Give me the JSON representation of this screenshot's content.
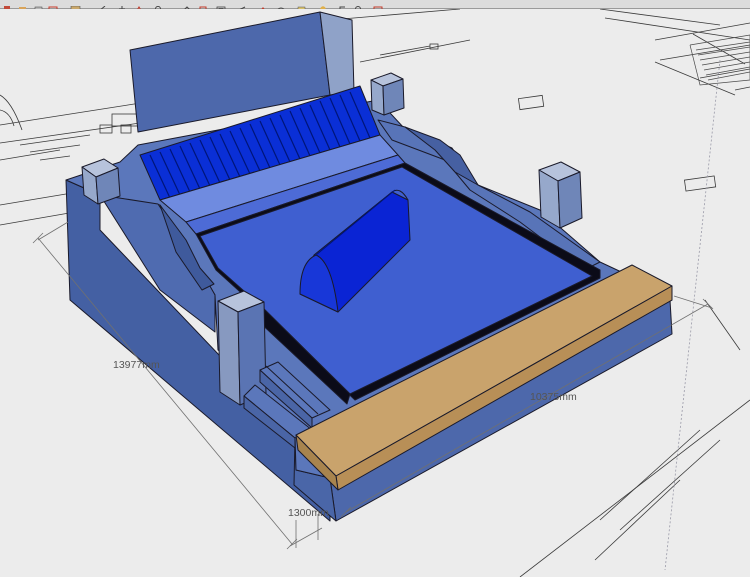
{
  "toolbar": {
    "buttons": [
      {
        "icon": "select-icon"
      },
      {
        "icon": "eraser-icon"
      },
      {
        "icon": "paint-bucket-icon"
      },
      {
        "icon": "rectangle-icon"
      },
      {
        "icon": "line-icon"
      },
      {
        "icon": "arc-icon"
      },
      {
        "icon": "move-icon"
      },
      {
        "icon": "push-pull-icon"
      },
      {
        "icon": "rotate-icon"
      },
      {
        "icon": "follow-me-icon"
      },
      {
        "icon": "scale-icon"
      },
      {
        "icon": "offset-icon"
      },
      {
        "icon": "tape-measure-icon"
      },
      {
        "icon": "dimension-icon"
      },
      {
        "icon": "protractor-icon"
      },
      {
        "icon": "text-icon"
      },
      {
        "icon": "orbit-icon"
      },
      {
        "icon": "pan-icon"
      },
      {
        "icon": "zoom-icon"
      },
      {
        "icon": "zoom-extents-icon"
      }
    ]
  },
  "model": {
    "dimensions": {
      "length": "13977mm",
      "width": "10375mm",
      "step_height": "1300mm"
    }
  },
  "colors": {
    "background": "#ececec",
    "structure_side": "#4a65a6",
    "structure_top": "#5b78be",
    "pool_surface": "#3f5fd0",
    "ramp_blue": "#0a2fd6",
    "cylinder": "#0a24d4",
    "deck_tan": "#c9a36c",
    "post_light": "#98a8c8"
  }
}
